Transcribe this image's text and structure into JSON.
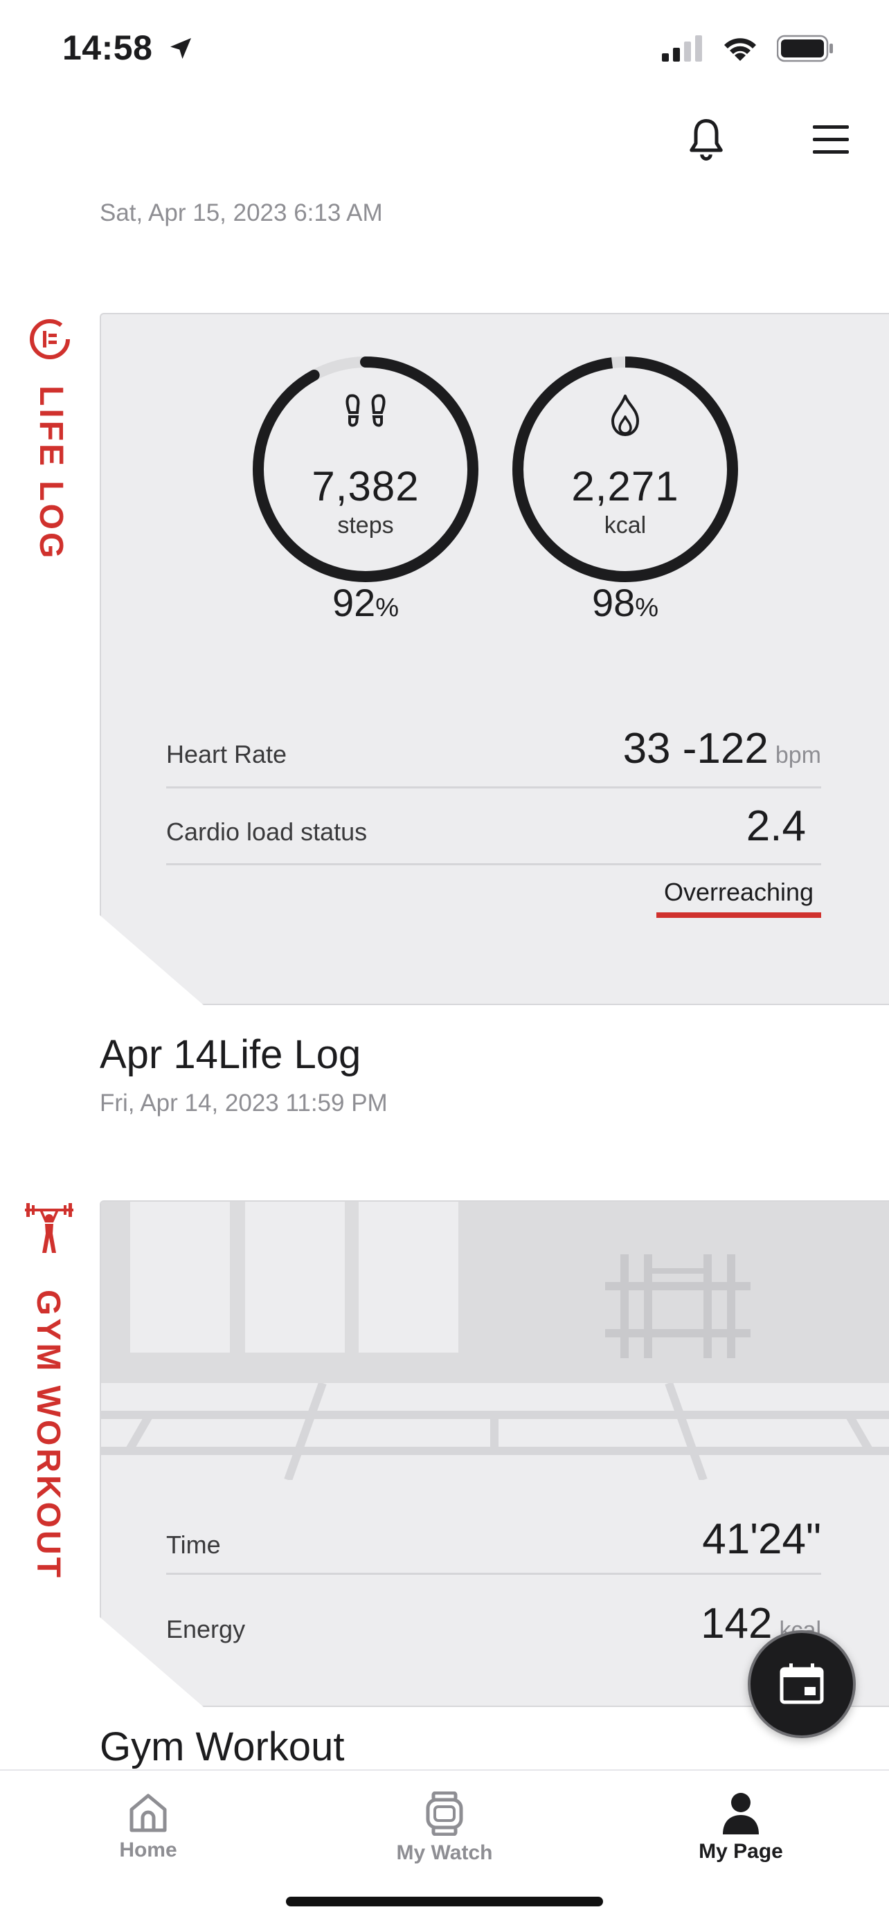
{
  "status_bar": {
    "time": "14:58"
  },
  "header": {
    "bell_icon": "bell-icon",
    "menu_icon": "hamburger-menu-icon"
  },
  "life_log_card": {
    "timestamp": "Sat, Apr 15, 2023 6:13 AM",
    "side_label": "LIFE LOG",
    "steps": {
      "value": "7,382",
      "unit": "steps",
      "percent": "92",
      "percent_sign": "%",
      "icon": "footprints-icon",
      "progress": 0.92
    },
    "calories": {
      "value": "2,271",
      "unit": "kcal",
      "percent": "98",
      "percent_sign": "%",
      "icon": "flame-icon",
      "progress": 0.98
    },
    "heart_rate": {
      "label": "Heart Rate",
      "value": "33 -122",
      "unit": "bpm"
    },
    "cardio_load": {
      "label": "Cardio load status",
      "value": "2.4",
      "status": "Overreaching",
      "status_color": "#d0312d"
    }
  },
  "life_log_entry": {
    "title": "Apr 14Life Log",
    "date": "Fri, Apr 14, 2023 11:59 PM"
  },
  "gym_card": {
    "side_label": "GYM WORKOUT",
    "time": {
      "label": "Time",
      "value": "41'24\""
    },
    "energy": {
      "label": "Energy",
      "value": "142",
      "unit": "kcal"
    }
  },
  "gym_entry": {
    "title": "Gym Workout"
  },
  "fab": {
    "icon": "calendar-icon"
  },
  "tabbar": {
    "tabs": [
      {
        "label": "Home",
        "icon": "home-icon",
        "active": false
      },
      {
        "label": "My Watch",
        "icon": "watch-icon",
        "active": false
      },
      {
        "label": "My Page",
        "icon": "person-icon",
        "active": true
      }
    ]
  },
  "colors": {
    "accent": "#d0312d",
    "ring": "#1c1c1e",
    "card_bg": "#ededef"
  }
}
